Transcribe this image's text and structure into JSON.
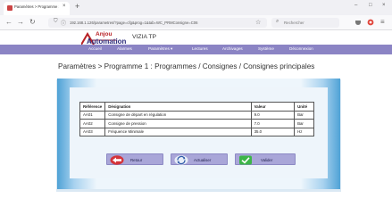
{
  "browser": {
    "tab_title": "Paramètres > Programme 1 : P",
    "tab_close": "×",
    "new_tab": "+",
    "window_buttons": [
      "–",
      "□",
      "×"
    ],
    "url": "192.168.1.126/parametres/?page=cfg&prog=1&tab=WC_PRMConsigne=C06",
    "search_placeholder": "Rechercher"
  },
  "app": {
    "logo_line1": "Anjou",
    "logo_line2": "Automation",
    "title": "VIZIA TP",
    "brand_color": "#8b84c4",
    "menu": [
      "Accueil",
      "Alarmes",
      "Paramètres ▾",
      "Lectures",
      "Archivages",
      "Système",
      "Déconnexion"
    ]
  },
  "breadcrumb": "Paramètres > Programme 1 : Programmes / Consignes / Consignes principales",
  "table": {
    "headers": [
      "Référence",
      "Désignation",
      "Valeur",
      "Unité"
    ],
    "rows": [
      {
        "ref": "AA01",
        "label": "Consigne de départ en régulation",
        "value": "9.0",
        "unit": "Bar"
      },
      {
        "ref": "AA02",
        "label": "Consigne de pression",
        "value": "7.0",
        "unit": "Bar"
      },
      {
        "ref": "AA03",
        "label": "Fréquence Minimale",
        "value": "35.0",
        "unit": "Hz"
      }
    ]
  },
  "buttons": {
    "back": "Retour",
    "refresh": "Actualiser",
    "validate": "Valider"
  }
}
